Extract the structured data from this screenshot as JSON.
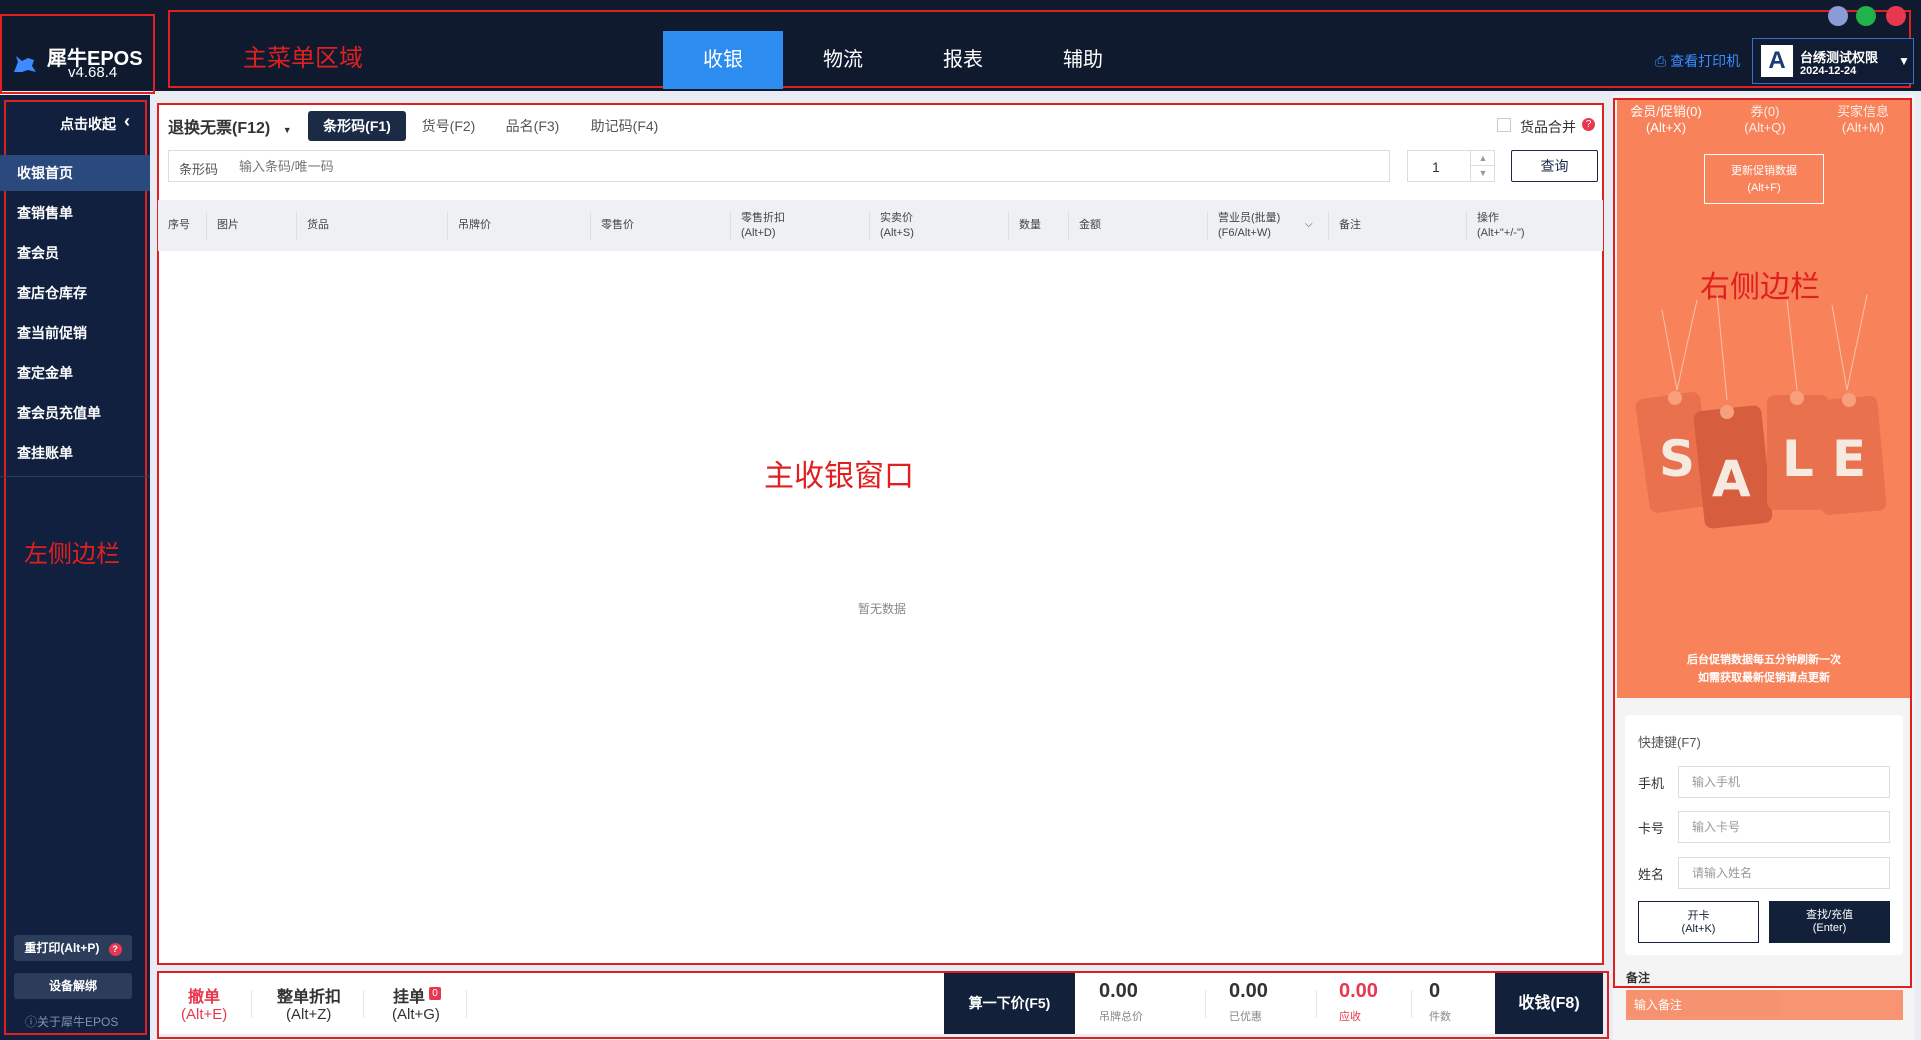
{
  "app": {
    "name": "犀牛EPOS",
    "version": "v4.68.4"
  },
  "annotations": {
    "menu_area": "主菜单区域",
    "left_sidebar": "左侧边栏",
    "main_window": "主收银窗口",
    "right_sidebar": "右侧边栏"
  },
  "nav": {
    "items": [
      "收银",
      "物流",
      "报表",
      "辅助"
    ],
    "active": "收银"
  },
  "header": {
    "printer_link": "查看打印机",
    "user": {
      "avatar": "A",
      "name": "台绣测试权限",
      "date": "2024-12-24"
    }
  },
  "sidebar": {
    "collapse_label": "点击收起",
    "items": [
      "收银首页",
      "查销售单",
      "查会员",
      "查店仓库存",
      "查当前促销",
      "查定金单",
      "查会员充值单",
      "查挂账单"
    ],
    "reprint_button": "重打印(Alt+P)",
    "device_unbind_button": "设备解绑",
    "about": "ⓘ关于犀牛EPOS"
  },
  "main": {
    "refund_dropdown": "退换无票(F12)",
    "search_tabs": [
      "条形码(F1)",
      "货号(F2)",
      "品名(F3)",
      "助记码(F4)"
    ],
    "merge_label": "货品合并",
    "search": {
      "label": "条形码",
      "placeholder": "输入条码/唯一码"
    },
    "quantity": "1",
    "query_button": "查询",
    "columns": {
      "seq": "序号",
      "image": "图片",
      "goods": "货品",
      "tag_price": "吊牌价",
      "retail_price": "零售价",
      "retail_discount": "零售折扣",
      "retail_discount_key": "(Alt+D)",
      "actual_price": "实卖价",
      "actual_price_key": "(Alt+S)",
      "qty": "数量",
      "amount": "金额",
      "salesperson": "营业员(批量)",
      "salesperson_key": "(F6/Alt+W)",
      "remark": "备注",
      "operation": "操作",
      "operation_key": "(Alt+\"+/-\")"
    },
    "empty_text": "暂无数据"
  },
  "bottom": {
    "cancel": {
      "label": "撤单",
      "key": "(Alt+E)"
    },
    "discount": {
      "label": "整单折扣",
      "key": "(Alt+Z)"
    },
    "hold": {
      "label": "挂单",
      "key": "(Alt+G)",
      "badge": "0"
    },
    "calc_button": "算一下价(F5)",
    "stats": [
      {
        "value": "0.00",
        "label": "吊牌总价"
      },
      {
        "value": "0.00",
        "label": "已优惠"
      },
      {
        "value": "0.00",
        "label": "应收"
      },
      {
        "value": "0",
        "label": "件数"
      }
    ],
    "pay_button": "收钱(F8)"
  },
  "right": {
    "tabs": [
      {
        "label": "会员/促销(0)",
        "key": "(Alt+X)"
      },
      {
        "label": "券(0)",
        "key": "(Alt+Q)"
      },
      {
        "label": "买家信息",
        "key": "(Alt+M)"
      }
    ],
    "update_button": {
      "label": "更新促销数据",
      "key": "(Alt+F)"
    },
    "sale_tags": [
      "S",
      "A",
      "L",
      "E"
    ],
    "promo_note_1": "后台促销数据每五分钟刷新一次",
    "promo_note_2": "如需获取最新促销请点更新",
    "shortcut_title": "快捷键(F7)",
    "fields": [
      {
        "label": "手机",
        "placeholder": "输入手机"
      },
      {
        "label": "卡号",
        "placeholder": "输入卡号"
      },
      {
        "label": "姓名",
        "placeholder": "请输入姓名"
      }
    ],
    "open_card_button": {
      "label": "开卡",
      "key": "(Alt+K)"
    },
    "find_button": {
      "label": "查找/充值",
      "key": "(Enter)"
    },
    "note_label": "备注",
    "note_placeholder": "输入备注"
  },
  "colors": {
    "accent": "#2d8cf0",
    "dark": "#12203a",
    "promo": "#f8825a",
    "annotation": "#e02020"
  }
}
